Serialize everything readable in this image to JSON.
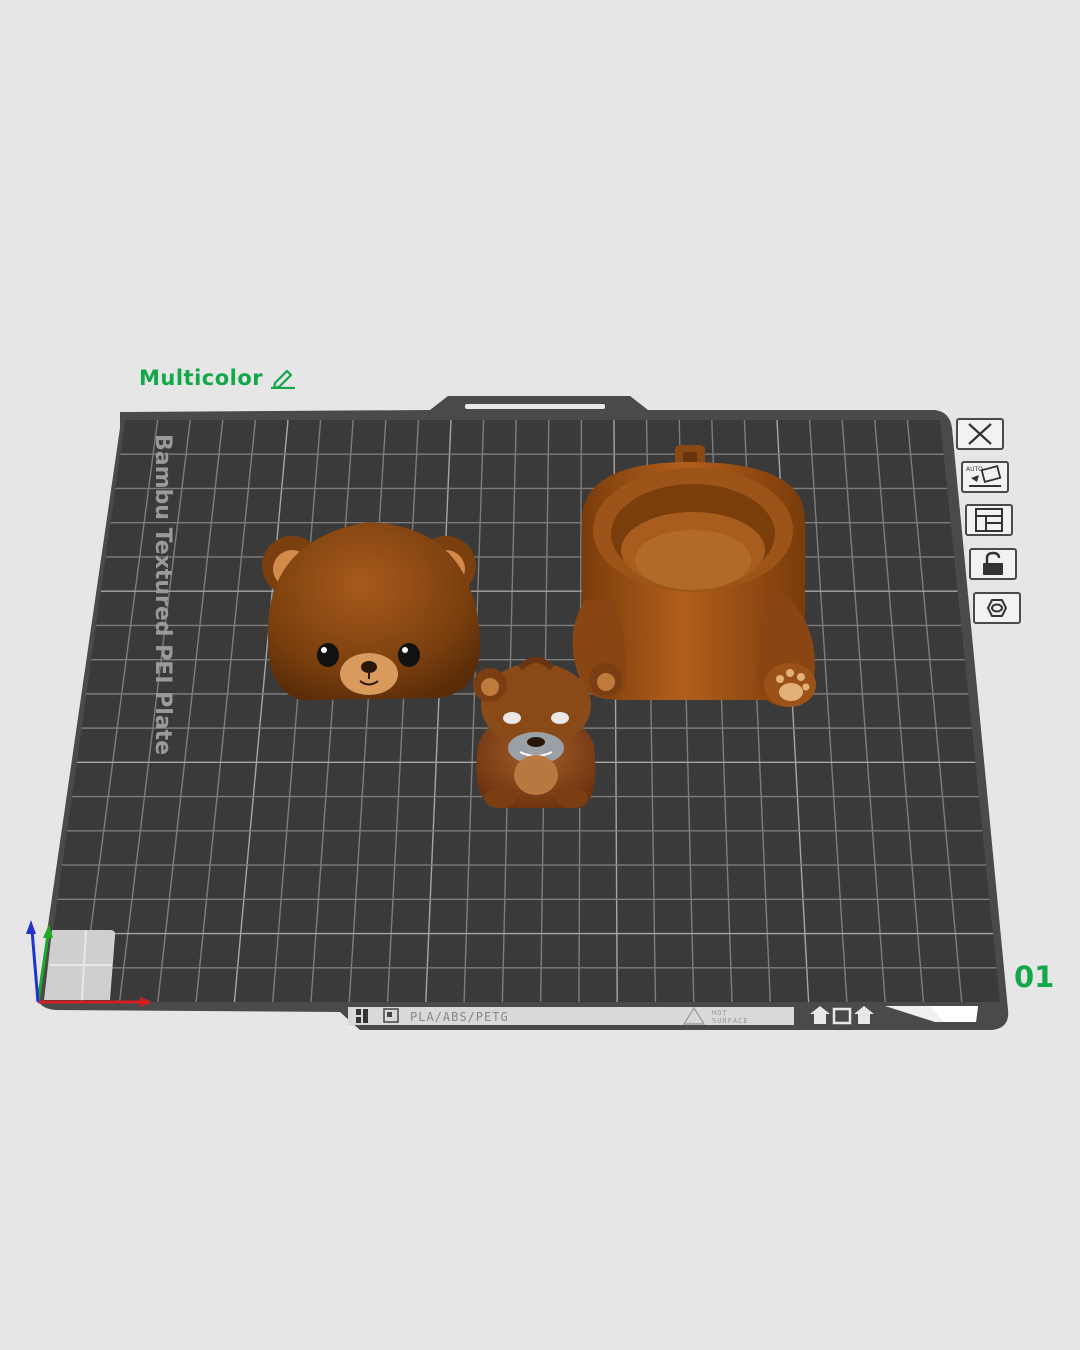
{
  "plate": {
    "name": "Multicolor",
    "number": "01",
    "bed_label": "Bambu Textured PEI Plate",
    "material_label": "PLA/ABS/PETG",
    "warning_label_line1": "HOT",
    "warning_label_line2": "SURFACE"
  },
  "toolbar": {
    "auto_label": "AUTO"
  },
  "colors": {
    "accent": "#12a84a",
    "background": "#e6e6e6",
    "bed": "#3c3c3c",
    "grid": "#8a8a8a",
    "model_brown": "#8a4a12",
    "model_light": "#c47a3a",
    "axis_x": "#d11f1f",
    "axis_y": "#1fa82a",
    "axis_z": "#2232d1"
  },
  "icons": [
    "edit-icon",
    "close-plate-icon",
    "auto-orient-icon",
    "arrange-icon",
    "lock-icon",
    "plate-settings-icon"
  ]
}
